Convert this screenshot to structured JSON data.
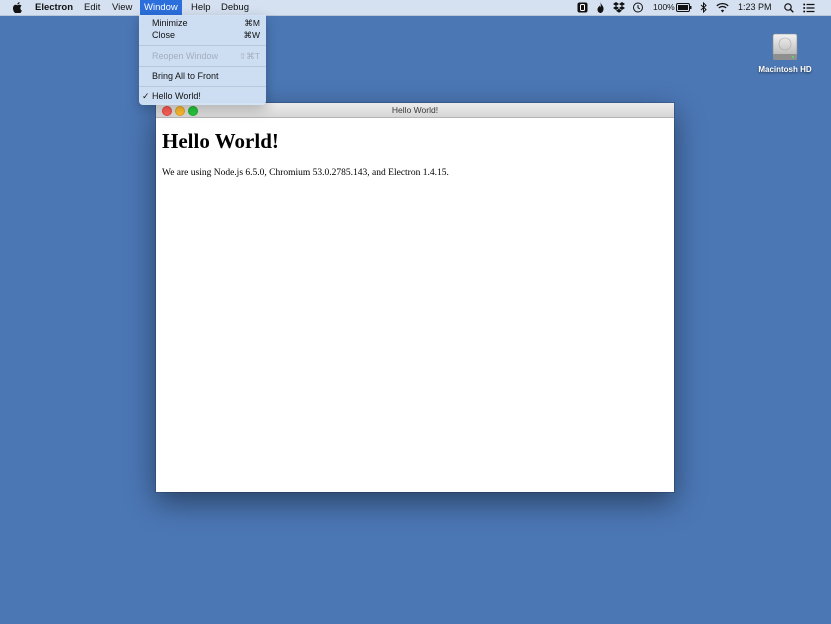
{
  "menubar": {
    "app_name": "Electron",
    "menus": [
      "Edit",
      "View",
      "Window",
      "Help",
      "Debug"
    ],
    "battery": "100%",
    "clock": "1:23 PM"
  },
  "window_menu": {
    "minimize": {
      "label": "Minimize",
      "shortcut": "⌘M"
    },
    "close": {
      "label": "Close",
      "shortcut": "⌘W"
    },
    "reopen": {
      "label": "Reopen Window",
      "shortcut": "⇧⌘T"
    },
    "bring_all": {
      "label": "Bring All to Front"
    },
    "hello_world": {
      "label": "Hello World!",
      "check": "✓"
    }
  },
  "desktop": {
    "hd_label": "Macintosh HD"
  },
  "app_window": {
    "title": "Hello World!",
    "heading": "Hello World!",
    "body_text": "We are using Node.js 6.5.0, Chromium 53.0.2785.143, and Electron 1.4.15."
  },
  "colors": {
    "desktop": "#4b77b5",
    "menu_highlight": "#2b6fdc"
  }
}
